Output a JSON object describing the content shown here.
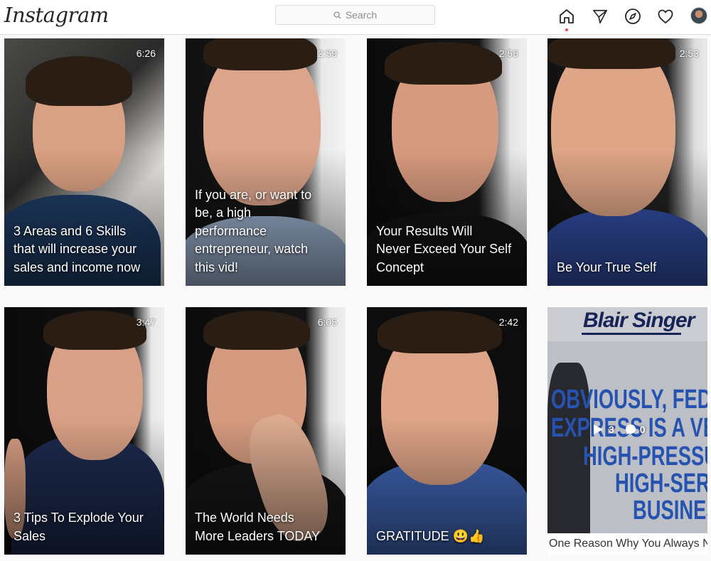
{
  "header": {
    "logo": "Instagram",
    "search_placeholder": "Search",
    "nav_icons": [
      "home-icon",
      "direct-icon",
      "explore-icon",
      "activity-icon",
      "profile-avatar"
    ]
  },
  "posts": [
    {
      "duration": "6:26",
      "caption": "3 Areas and 6 Skills\nthat will increase your\nsales and income now"
    },
    {
      "duration": "2:59",
      "caption": "If you are, or want to\nbe, a high\nperformance\nentrepreneur, watch\nthis vid!"
    },
    {
      "duration": "2:56",
      "caption": "Your Results Will\nNever Exceed Your Self\nConcept"
    },
    {
      "duration": "2:53",
      "caption": "Be Your True Self"
    },
    {
      "duration": "3:47",
      "caption": "3 Tips To Explode Your\nSales"
    },
    {
      "duration": "6:05",
      "caption": "The World Needs\nMore Leaders TODAY"
    },
    {
      "duration": "2:42",
      "caption": "GRATITUDE 😃👍"
    },
    {
      "brand": "Blair Singer",
      "line1": "OBVIOUSLY, FEDE",
      "line2": "EXPRESS IS A VE",
      "line3": "HIGH-PRESSU",
      "line4": "HIGH-SERV",
      "line5": "BUSINES",
      "bottom_text": "One Reason Why You Always N",
      "views": "3",
      "comments": "0"
    }
  ],
  "colors": {
    "accent_dot": "#ed4956",
    "brand_navy": "#1b2a63",
    "brand_blue": "#2c5fc9"
  }
}
